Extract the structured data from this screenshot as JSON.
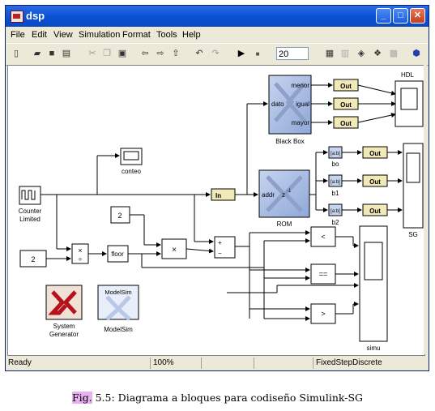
{
  "window": {
    "title": "dsp"
  },
  "menu": [
    "File",
    "Edit",
    "View",
    "Simulation",
    "Format",
    "Tools",
    "Help"
  ],
  "toolbar": {
    "sim_stop_time": "20"
  },
  "blocks": {
    "hdl_title": "HDL",
    "black_box_label": "Black Box",
    "bb_port_menor": "menor",
    "bb_port_dato": "dato",
    "bb_port_igual": "igual",
    "bb_port_mayor": "mayor",
    "out": "Out",
    "conteo": "conteo",
    "counter_label_1": "Counter",
    "counter_label_2": "Limited",
    "in": "In",
    "rom_label": "ROM",
    "rom_addr": "addr",
    "rom_z": "z",
    "rom_exp": "-1",
    "slice": "[a:b]",
    "bo": "bo",
    "b1": "b1",
    "b2": "b2",
    "sg": "SG",
    "const1": "2",
    "const2": "2",
    "floor": "floor",
    "times": "×",
    "lt": "<",
    "eq": "==",
    "gt": ">",
    "simu": "simu",
    "sysgen_1": "System",
    "sysgen_2": "Generator",
    "modelsim_top": "ModelSim",
    "modelsim_bottom": "ModelSim"
  },
  "status": {
    "state": "Ready",
    "zoom": "100%",
    "solver": "FixedStepDiscrete"
  },
  "caption": {
    "prefix": "Fig.",
    "text": "5.5: Diagrama a bloques para codiseño Simulink-SG"
  }
}
